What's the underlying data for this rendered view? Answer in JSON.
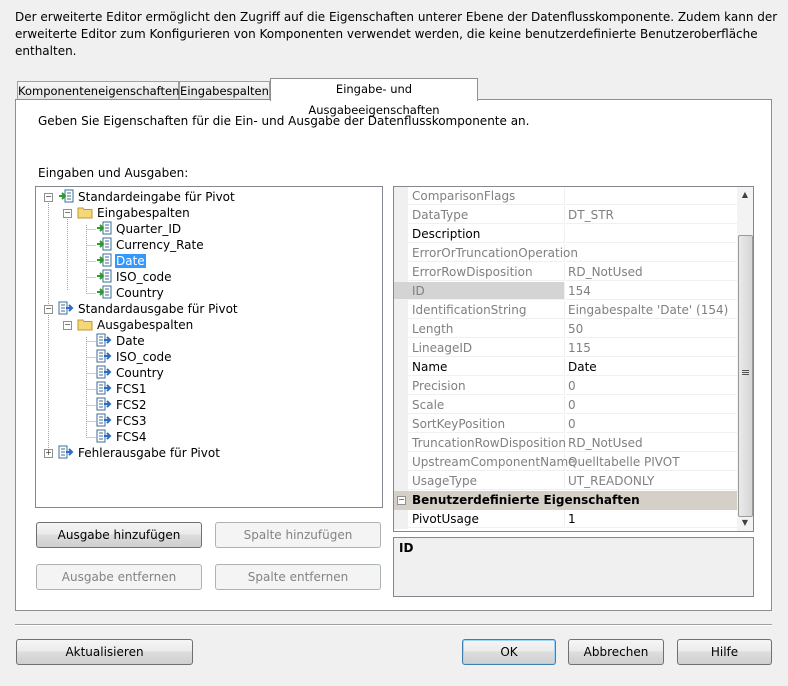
{
  "intro": "Der erweiterte Editor ermöglicht den Zugriff auf die Eigenschaften unterer Ebene der Datenflusskomponente. Zudem kann der erweiterte Editor zum Konfigurieren von Komponenten verwendet werden, die keine benutzerdefinierte Benutzeroberfläche enthalten.",
  "tabs": [
    {
      "label": "Komponenteneigenschaften"
    },
    {
      "label": "Eingabespalten"
    },
    {
      "label": "Eingabe- und Ausgabeeigenschaften"
    }
  ],
  "instruction": "Geben Sie Eigenschaften für die Ein- und Ausgabe der Datenflusskomponente an.",
  "io_label": "Eingaben und Ausgaben:",
  "tree": [
    {
      "label": "Standardeingabe für Pivot",
      "icon": "input-icon"
    },
    {
      "label": "Eingabespalten",
      "icon": "folder-icon"
    },
    {
      "label": "Quarter_ID",
      "icon": "input-column-icon"
    },
    {
      "label": "Currency_Rate",
      "icon": "input-column-icon"
    },
    {
      "label": "Date",
      "icon": "input-column-icon",
      "selected": true
    },
    {
      "label": "ISO_code",
      "icon": "input-column-icon"
    },
    {
      "label": "Country",
      "icon": "input-column-icon"
    },
    {
      "label": "Standardausgabe für Pivot",
      "icon": "output-icon"
    },
    {
      "label": "Ausgabespalten",
      "icon": "folder-icon"
    },
    {
      "label": "Date",
      "icon": "output-column-icon"
    },
    {
      "label": "ISO_code",
      "icon": "output-column-icon"
    },
    {
      "label": "Country",
      "icon": "output-column-icon"
    },
    {
      "label": "FCS1",
      "icon": "output-column-icon"
    },
    {
      "label": "FCS2",
      "icon": "output-column-icon"
    },
    {
      "label": "FCS3",
      "icon": "output-column-icon"
    },
    {
      "label": "FCS4",
      "icon": "output-column-icon"
    },
    {
      "label": "Fehlerausgabe für Pivot",
      "icon": "output-icon"
    }
  ],
  "buttons": {
    "add_output": "Ausgabe hinzufügen",
    "add_column": "Spalte hinzufügen",
    "remove_output": "Ausgabe entfernen",
    "remove_column": "Spalte entfernen",
    "refresh": "Aktualisieren",
    "ok": "OK",
    "cancel": "Abbrechen",
    "help": "Hilfe"
  },
  "properties": [
    {
      "name": "ComparisonFlags",
      "value": "",
      "readonly": true
    },
    {
      "name": "DataType",
      "value": "DT_STR",
      "readonly": true
    },
    {
      "name": "Description",
      "value": "",
      "readonly": false
    },
    {
      "name": "ErrorOrTruncationOperation",
      "value": "",
      "readonly": true
    },
    {
      "name": "ErrorRowDisposition",
      "value": "RD_NotUsed",
      "readonly": true
    },
    {
      "name": "ID",
      "value": "154",
      "readonly": true,
      "selected": true
    },
    {
      "name": "IdentificationString",
      "value": "Eingabespalte 'Date' (154)",
      "readonly": true
    },
    {
      "name": "Length",
      "value": "50",
      "readonly": true
    },
    {
      "name": "LineageID",
      "value": "115",
      "readonly": true
    },
    {
      "name": "Name",
      "value": "Date",
      "readonly": false
    },
    {
      "name": "Precision",
      "value": "0",
      "readonly": true
    },
    {
      "name": "Scale",
      "value": "0",
      "readonly": true
    },
    {
      "name": "SortKeyPosition",
      "value": "0",
      "readonly": true
    },
    {
      "name": "TruncationRowDisposition",
      "value": "RD_NotUsed",
      "readonly": true
    },
    {
      "name": "UpstreamComponentName",
      "value": "Quelltabelle PIVOT",
      "readonly": true
    },
    {
      "name": "UsageType",
      "value": "UT_READONLY",
      "readonly": true
    }
  ],
  "custom_category": "Benutzerdefinierte Eigenschaften",
  "custom_properties": [
    {
      "name": "PivotUsage",
      "value": "1",
      "readonly": false
    }
  ],
  "description_title": "ID",
  "colors": {
    "selection": "#3399ff",
    "readonly_text": "#808080",
    "category_bg": "#d4d0c8"
  }
}
